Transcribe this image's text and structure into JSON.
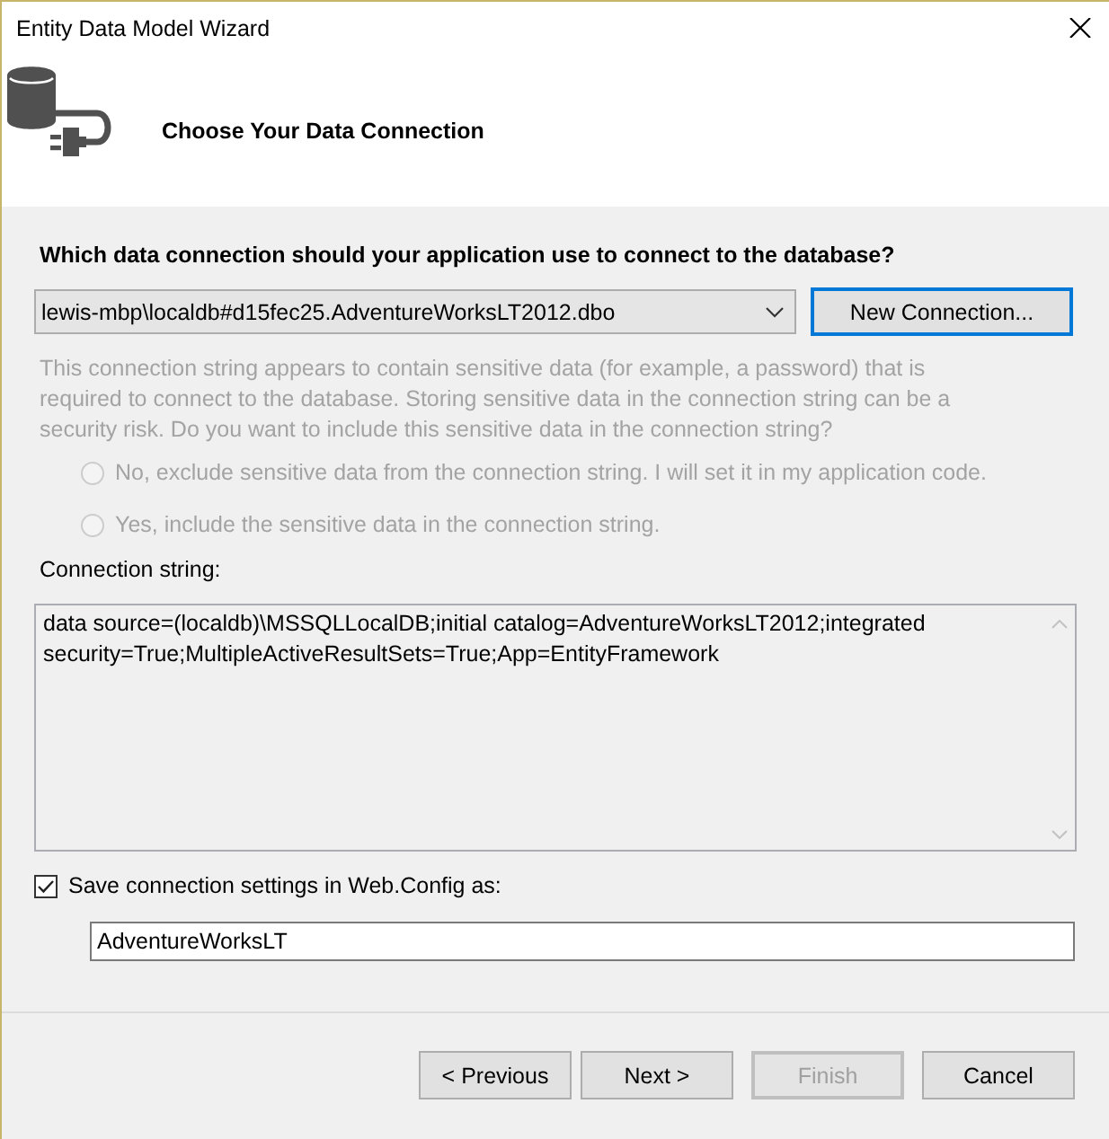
{
  "window": {
    "title": "Entity Data Model Wizard"
  },
  "header": {
    "title": "Choose Your Data Connection"
  },
  "question": "Which data connection should your application use to connect to the database?",
  "connection_dropdown": {
    "value": "lewis-mbp\\localdb#d15fec25.AdventureWorksLT2012.dbo"
  },
  "new_connection_button": {
    "label": "New Connection...",
    "focused": true
  },
  "sensitive_data": {
    "disabled": true,
    "text": "This connection string appears to contain sensitive data (for example, a password) that is\nrequired to connect to the database. Storing sensitive data in the connection string can be a\nsecurity risk. Do you want to include this sensitive data in the connection string?",
    "options": [
      {
        "label": "No, exclude sensitive data from the connection string. I will set it in my application code.",
        "selected": false
      },
      {
        "label": "Yes, include the sensitive data in the connection string.",
        "selected": false
      }
    ]
  },
  "connection_string": {
    "label": "Connection string:",
    "value": "data source=(localdb)\\MSSQLLocalDB;initial catalog=AdventureWorksLT2012;integrated security=True;MultipleActiveResultSets=True;App=EntityFramework"
  },
  "save_setting": {
    "label": "Save connection settings in Web.Config as:",
    "checked": true
  },
  "config_name": {
    "value": "AdventureWorksLT"
  },
  "buttons": [
    {
      "label": "< Previous",
      "disabled": false
    },
    {
      "label": "Next >",
      "disabled": false
    },
    {
      "label": "Finish",
      "disabled": true
    },
    {
      "label": "Cancel",
      "disabled": false
    }
  ]
}
